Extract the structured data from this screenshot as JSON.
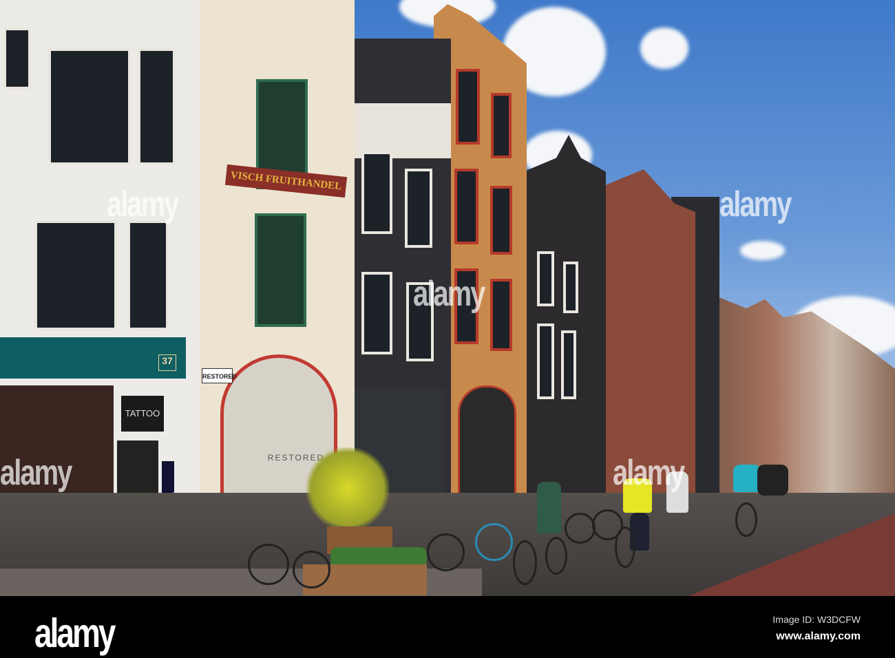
{
  "photo": {
    "subject": "Amsterdam street with cyclists",
    "signs": {
      "shop_sign": "VISCH FRUITHANDEL",
      "house_number": "37",
      "tattoo_sign": "TATTOO",
      "tattoo_vertical": "TATTOO",
      "restored_sign": "RESTORED",
      "restored_window": "RESTORED"
    },
    "watermark": "alamy",
    "colors": {
      "sky": "#4a82cc",
      "bike_lane": "#7a3b35",
      "footer": "#000000"
    }
  },
  "footer": {
    "logo": "alamy",
    "image_id": "Image ID: W3DCFW",
    "url": "www.alamy.com"
  }
}
